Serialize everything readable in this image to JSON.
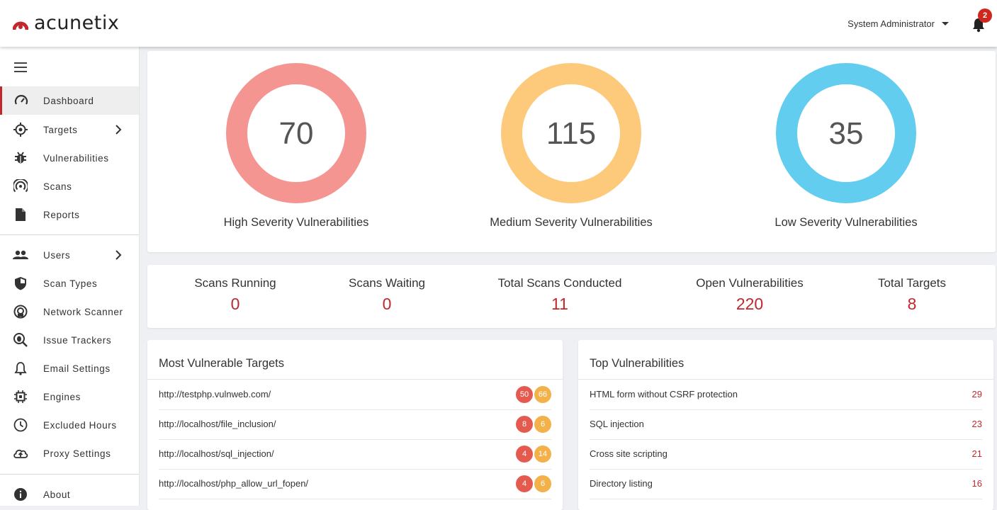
{
  "app": {
    "name": "acunetix",
    "brand_color": "#c0282d"
  },
  "header": {
    "user": "System Administrator",
    "notifications": "2"
  },
  "sidebar": {
    "items": [
      {
        "label": "Dashboard",
        "icon": "dashboard-gauge-icon",
        "active": true
      },
      {
        "label": "Targets",
        "icon": "crosshair-icon",
        "has_submenu": true
      },
      {
        "label": "Vulnerabilities",
        "icon": "bug-icon"
      },
      {
        "label": "Scans",
        "icon": "radar-icon"
      },
      {
        "label": "Reports",
        "icon": "document-icon"
      },
      {
        "label": "Users",
        "icon": "users-icon",
        "has_submenu": true
      },
      {
        "label": "Scan Types",
        "icon": "shield-icon"
      },
      {
        "label": "Network Scanner",
        "icon": "network-scanner-icon"
      },
      {
        "label": "Issue Trackers",
        "icon": "bug-search-icon"
      },
      {
        "label": "Email Settings",
        "icon": "bell-outline-icon"
      },
      {
        "label": "Engines",
        "icon": "chip-icon"
      },
      {
        "label": "Excluded Hours",
        "icon": "clock-icon"
      },
      {
        "label": "Proxy Settings",
        "icon": "cloud-upload-icon"
      },
      {
        "label": "About",
        "icon": "info-icon"
      }
    ]
  },
  "severity": [
    {
      "value": "70",
      "label": "High Severity Vulnerabilities",
      "color": "#f59592"
    },
    {
      "value": "115",
      "label": "Medium Severity Vulnerabilities",
      "color": "#fdc97b"
    },
    {
      "value": "35",
      "label": "Low Severity Vulnerabilities",
      "color": "#62cdee"
    }
  ],
  "stats": [
    {
      "label": "Scans Running",
      "value": "0"
    },
    {
      "label": "Scans Waiting",
      "value": "0"
    },
    {
      "label": "Total Scans Conducted",
      "value": "11"
    },
    {
      "label": "Open Vulnerabilities",
      "value": "220"
    },
    {
      "label": "Total Targets",
      "value": "8"
    }
  ],
  "most_vulnerable": {
    "title": "Most Vulnerable Targets",
    "rows": [
      {
        "url": "http://testphp.vulnweb.com/",
        "high": "50",
        "medium": "66"
      },
      {
        "url": "http://localhost/file_inclusion/",
        "high": "8",
        "medium": "6"
      },
      {
        "url": "http://localhost/sql_injection/",
        "high": "4",
        "medium": "14"
      },
      {
        "url": "http://localhost/php_allow_url_fopen/",
        "high": "4",
        "medium": "6"
      }
    ]
  },
  "top_vulnerabilities": {
    "title": "Top Vulnerabilities",
    "rows": [
      {
        "name": "HTML form without CSRF protection",
        "count": "29"
      },
      {
        "name": "SQL injection",
        "count": "23"
      },
      {
        "name": "Cross site scripting",
        "count": "21"
      },
      {
        "name": "Directory listing",
        "count": "16"
      }
    ]
  }
}
